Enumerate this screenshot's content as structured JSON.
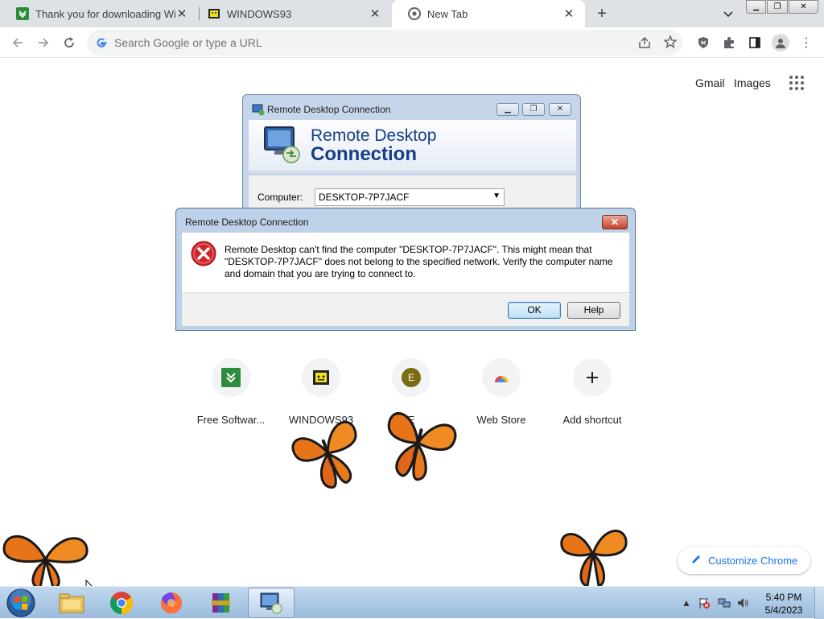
{
  "browser": {
    "tabs": [
      {
        "title": "Thank you for downloading WinR",
        "favicon": "fosshub-green-icon",
        "active": false
      },
      {
        "title": "WINDOWS93",
        "favicon": "windows93-icon",
        "active": false
      },
      {
        "title": "New Tab",
        "favicon": "chrome-icon",
        "active": true
      }
    ],
    "new_tab_symbol": "+",
    "omnibox_placeholder": "Search Google or type a URL"
  },
  "ntp": {
    "gmail": "Gmail",
    "images": "Images",
    "shortcuts": [
      {
        "label": "Free Softwar...",
        "icon": "fosshub-icon"
      },
      {
        "label": "WINDOWS93",
        "icon": "windows93-icon"
      },
      {
        "label": "E",
        "icon": "letter-e-icon",
        "letter": "E"
      },
      {
        "label": "Web Store",
        "icon": "web-store-icon"
      },
      {
        "label": "Add shortcut",
        "icon": "plus-icon"
      }
    ],
    "customize": "Customize Chrome"
  },
  "rdc_window": {
    "title": "Remote Desktop Connection",
    "heading_line1": "Remote Desktop",
    "heading_line2": "Connection",
    "computer_label": "Computer:",
    "computer_value": "DESKTOP-7P7JACF"
  },
  "error_dialog": {
    "title": "Remote Desktop Connection",
    "close_symbol": "✕",
    "message": "Remote Desktop can't find the computer \"DESKTOP-7P7JACF\". This might mean that \"DESKTOP-7P7JACF\" does not belong to the specified network.  Verify the computer name and domain that you are trying to connect to.",
    "ok_label": "OK",
    "help_label": "Help"
  },
  "taskbar": {
    "items": [
      "start-orb",
      "file-explorer",
      "chrome",
      "firefox",
      "winrar",
      "remote-desktop"
    ],
    "time": "5:40 PM",
    "date": "5/4/2023"
  },
  "colors": {
    "chrome_tabstrip": "#dee1e6",
    "link_blue": "#1a73e8",
    "rdc_heading": "#153e87",
    "error_red": "#d2232a"
  }
}
